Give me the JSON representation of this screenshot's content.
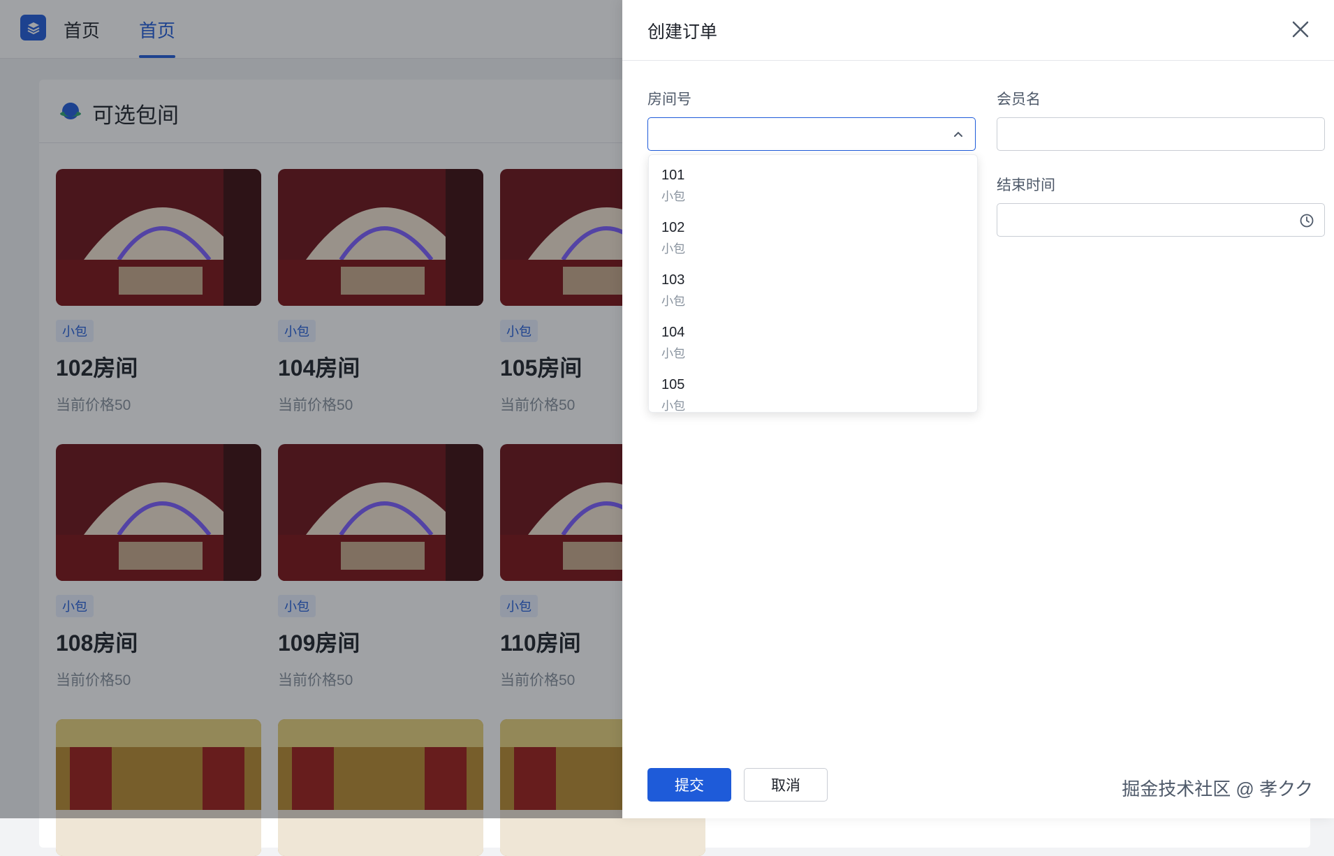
{
  "nav": {
    "tab1": "首页",
    "tab2": "首页"
  },
  "section": {
    "title": "可选包间"
  },
  "rooms": [
    {
      "tag": "小包",
      "name": "102房间",
      "price": "当前价格50"
    },
    {
      "tag": "小包",
      "name": "104房间",
      "price": "当前价格50"
    },
    {
      "tag": "小包",
      "name": "105房间",
      "price": "当前价格50"
    },
    {
      "tag": "小包",
      "name": "108房间",
      "price": "当前价格50"
    },
    {
      "tag": "小包",
      "name": "109房间",
      "price": "当前价格50"
    },
    {
      "tag": "小包",
      "name": "110房间",
      "price": "当前价格50"
    }
  ],
  "drawer": {
    "title": "创建订单",
    "room_label": "房间号",
    "member_label": "会员名",
    "end_time_label": "结束时间",
    "submit": "提交",
    "cancel": "取消"
  },
  "options": [
    {
      "num": "101",
      "sub": "小包"
    },
    {
      "num": "102",
      "sub": "小包"
    },
    {
      "num": "103",
      "sub": "小包"
    },
    {
      "num": "104",
      "sub": "小包"
    },
    {
      "num": "105",
      "sub": "小包"
    }
  ],
  "watermark": "掘金技术社区 @ 孝クク",
  "colors": {
    "primary": "#1e5bd9",
    "mask": "rgba(29,33,41,0.42)"
  }
}
